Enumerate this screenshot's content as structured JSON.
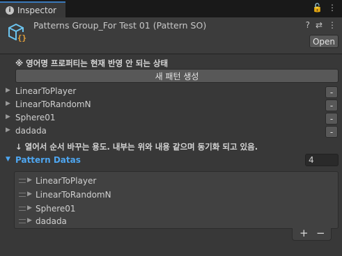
{
  "tab": {
    "title": "Inspector",
    "icon": "info-icon"
  },
  "tab_controls": {
    "lock": "🔓",
    "menu": "⋮"
  },
  "header": {
    "title": "Patterns Group_For Test 01 (Pattern SO)",
    "icon": "scriptable-object-icon",
    "help": "?",
    "settings": "⇄",
    "more": "⋮",
    "open_label": "Open"
  },
  "notice_top": "※ 영어명 프로퍼티는 현재 반영 안 되는 상태",
  "create_button": "새 패턴 생성",
  "patterns": [
    {
      "name": "LinearToPlayer",
      "remove": "-"
    },
    {
      "name": "LinearToRandomN",
      "remove": "-"
    },
    {
      "name": "Sphere01",
      "remove": "-"
    },
    {
      "name": "dadada",
      "remove": "-"
    }
  ],
  "notice_bottom": "↓ 열어서 순서 바꾸는 용도. 내부는 위와 내용 같으며 동기화 되고 있음.",
  "pattern_list": {
    "label": "Pattern Datas",
    "size": "4",
    "items": [
      "LinearToPlayer",
      "LinearToRandomN",
      "Sphere01",
      "dadada"
    ],
    "add": "+",
    "remove": "−"
  },
  "colors": {
    "accent": "#4ea6f0",
    "tab_highlight": "#3a79bb",
    "panel": "#383838"
  }
}
